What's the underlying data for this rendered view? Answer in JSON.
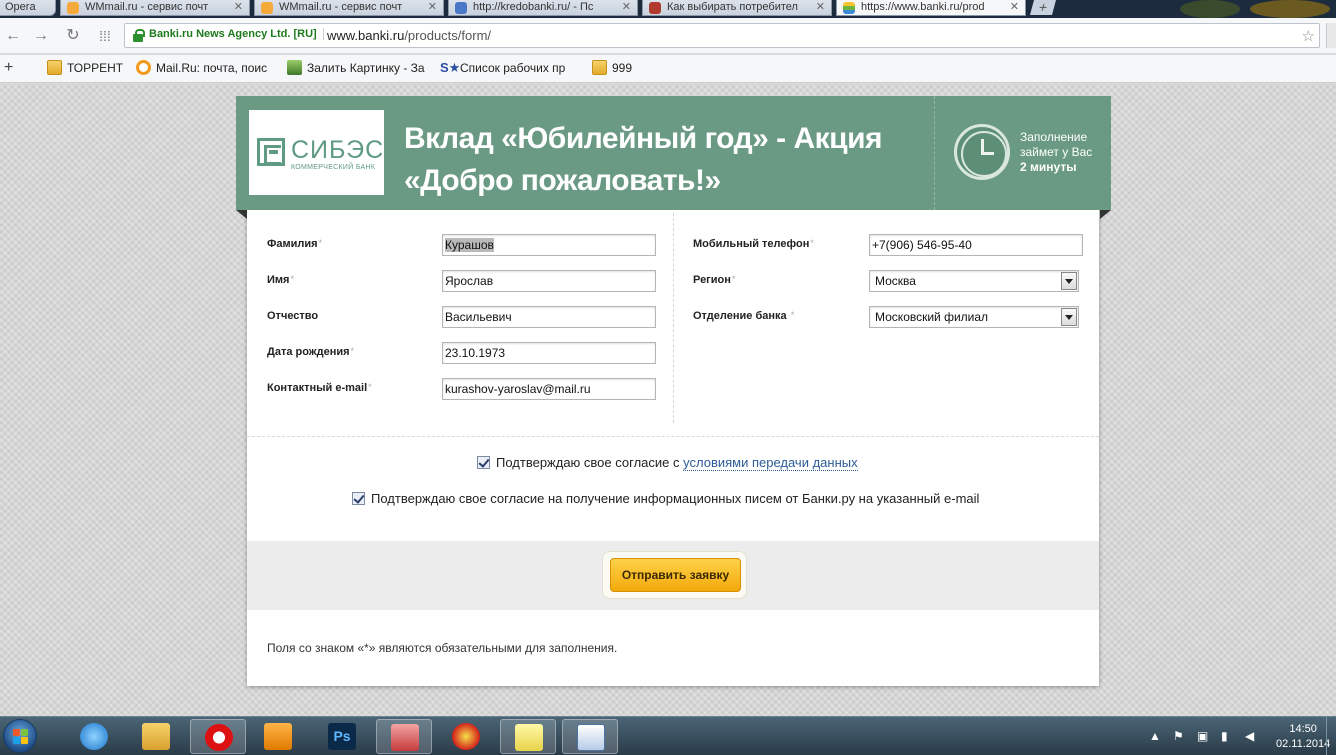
{
  "browser": {
    "tabs": [
      {
        "label": "Opera"
      },
      {
        "label": "WMmail.ru - сервис почт"
      },
      {
        "label": "WMmail.ru - сервис почт"
      },
      {
        "label": "http://kredobanki.ru/ - Пс"
      },
      {
        "label": "Как выбирать потребител"
      },
      {
        "label": "https://www.banki.ru/prod"
      }
    ],
    "new_tab": "+",
    "ev_label": "Banki.ru News Agency Ltd. [RU]",
    "url_host": "www.banki.ru",
    "url_path": "/products/form/",
    "bookmarks": [
      {
        "label": "ТОРРЕНТ",
        "icon": "folder-icon"
      },
      {
        "label": "Mail.Ru: почта, поис",
        "icon": "mailru-icon"
      },
      {
        "label": "Залить Картинку - За",
        "icon": "image-upload-icon"
      },
      {
        "label": "Список рабочих пр",
        "icon": "star-s-icon"
      },
      {
        "label": "999",
        "icon": "folder-icon"
      }
    ]
  },
  "header": {
    "logo_name": "СИБЭС",
    "logo_sub": "КОММЕРЧЕСКИЙ БАНК",
    "title": "Вклад «Юбилейный год» - Акция «Добро пожаловать!»",
    "fill_line1": "Заполнение",
    "fill_line2": "займет у Вас",
    "fill_bold": "2 минуты"
  },
  "form": {
    "left": [
      {
        "label": "Фамилия",
        "required": "*",
        "value": "Курашов"
      },
      {
        "label": "Имя",
        "required": "*",
        "value": "Ярослав"
      },
      {
        "label": "Отчество",
        "required": "",
        "value": "Васильевич"
      },
      {
        "label": "Дата рождения",
        "required": "*",
        "value": "23.10.1973"
      },
      {
        "label": "Контактный e-mail",
        "required": "*",
        "value": "kurashov-yaroslav@mail.ru"
      }
    ],
    "right": [
      {
        "label": "Мобильный телефон",
        "required": "*",
        "value": "+7(906) 546-95-40"
      },
      {
        "label": "Регион",
        "required": "*",
        "value": "Москва"
      },
      {
        "label": "Отделение банка ",
        "required": "*",
        "value": "Московский филиал"
      }
    ]
  },
  "consent": {
    "line1_text": "Подтверждаю свое согласие с ",
    "line1_link": "условиями передачи данных",
    "line2_text": "Подтверждаю свое согласие на получение информационных писем от Банки.ру на указанный e-mail"
  },
  "submit_label": "Отправить заявку",
  "footnote": "Поля со знаком «*» являются обязательными для заполнения.",
  "taskbar": {
    "time": "14:50",
    "date": "02.11.2014"
  },
  "colors": {
    "header_green": "#6a9a83",
    "button_orange": "#f3a80a",
    "link_blue": "#2c5b99"
  }
}
